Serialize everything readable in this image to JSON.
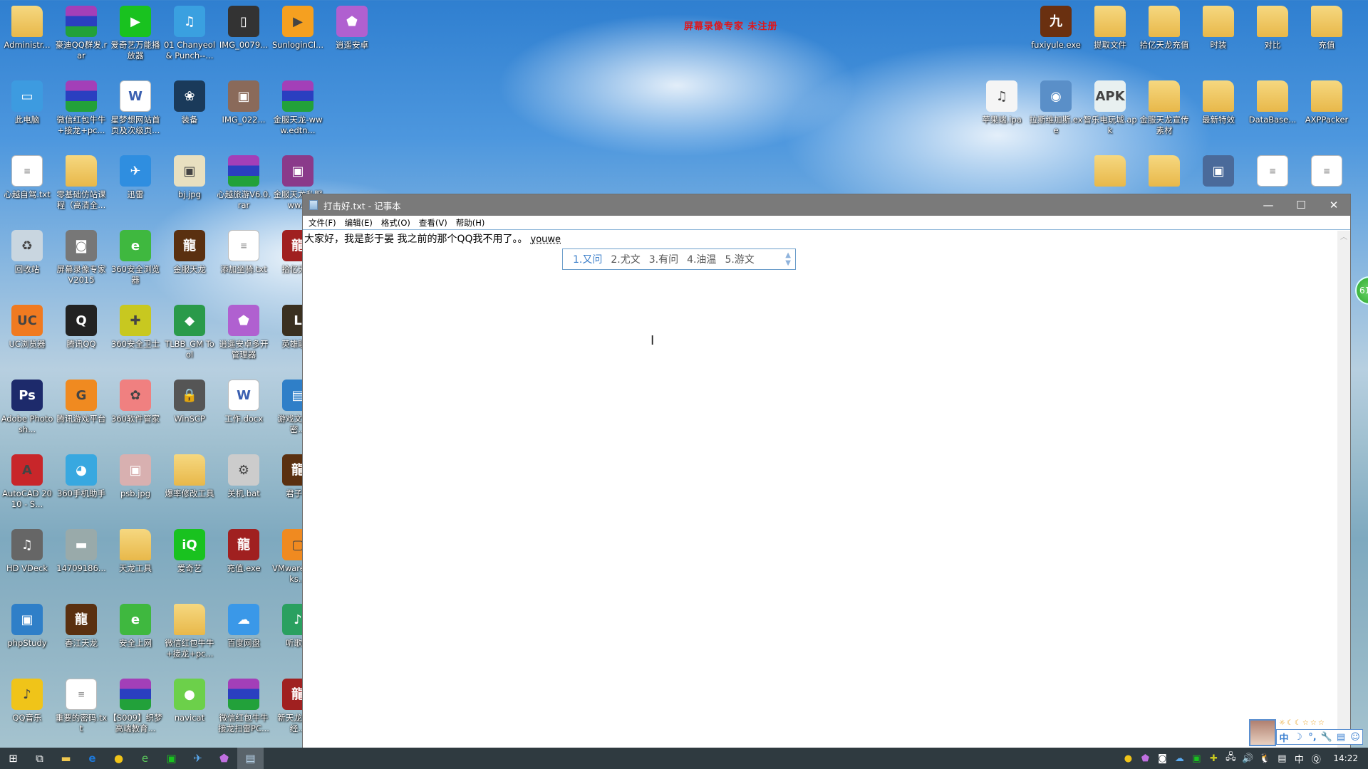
{
  "watermark": "屏幕录像专家  未注册",
  "desktop_left": [
    [
      {
        "label": "Administr...",
        "kind": "folder",
        "color": "#e8b84a"
      },
      {
        "label": "此电脑",
        "kind": "app",
        "color": "#3d9be0",
        "glyph": "▭"
      },
      {
        "label": "心越自驾.txt",
        "kind": "txt"
      },
      {
        "label": "回收站",
        "kind": "app",
        "color": "#c9d6e0",
        "glyph": "♻"
      },
      {
        "label": "UC浏览器",
        "kind": "app",
        "color": "#f07a20",
        "glyph": "UC"
      },
      {
        "label": "Adobe Photosh...",
        "kind": "app",
        "color": "#1d2a6b",
        "glyph": "Ps"
      },
      {
        "label": "AutoCAD 2010 - S...",
        "kind": "app",
        "color": "#c8262a",
        "glyph": "A"
      },
      {
        "label": "HD VDeck",
        "kind": "app",
        "color": "#666",
        "glyph": "♫"
      },
      {
        "label": "phpStudy",
        "kind": "app",
        "color": "#2f7fc8",
        "glyph": "▣"
      },
      {
        "label": "QQ音乐",
        "kind": "app",
        "color": "#f0c419",
        "glyph": "♪"
      }
    ],
    [
      {
        "label": "豪迪QQ群发.rar",
        "kind": "rar"
      },
      {
        "label": "微信红包牛牛+接龙+pc...",
        "kind": "rar"
      },
      {
        "label": "零基础仿站课程（高清全...",
        "kind": "folder"
      },
      {
        "label": "屏幕录像专家V2015",
        "kind": "app",
        "color": "#777",
        "glyph": "◙"
      },
      {
        "label": "腾讯QQ",
        "kind": "app",
        "color": "#222",
        "glyph": "Q"
      },
      {
        "label": "腾讯游戏平台",
        "kind": "app",
        "color": "#f08a20",
        "glyph": "G"
      },
      {
        "label": "360手机助手",
        "kind": "app",
        "color": "#38a8e0",
        "glyph": "◕"
      },
      {
        "label": "14709186...",
        "kind": "app",
        "color": "#9aa",
        "glyph": "▬"
      },
      {
        "label": "香江天龙",
        "kind": "app",
        "color": "#5a3010",
        "glyph": "龍"
      },
      {
        "label": "重要的密码.txt",
        "kind": "txt"
      }
    ],
    [
      {
        "label": "爱奇艺万能播放器",
        "kind": "app",
        "color": "#19c21f",
        "glyph": "▶"
      },
      {
        "label": "星梦想网站首页及次级页...",
        "kind": "doc"
      },
      {
        "label": "迅雷",
        "kind": "app",
        "color": "#2f8ee0",
        "glyph": "✈"
      },
      {
        "label": "360安全浏览器",
        "kind": "app",
        "color": "#3fb83f",
        "glyph": "e"
      },
      {
        "label": "360安全卫士",
        "kind": "app",
        "color": "#c8c820",
        "glyph": "✚"
      },
      {
        "label": "360软件管家",
        "kind": "app",
        "color": "#f08080",
        "glyph": "✿"
      },
      {
        "label": "psb.jpg",
        "kind": "app",
        "color": "#d8b0b0",
        "glyph": "▣"
      },
      {
        "label": "天龙工具",
        "kind": "folder"
      },
      {
        "label": "安全上网",
        "kind": "app",
        "color": "#3fb83f",
        "glyph": "e"
      },
      {
        "label": "【S009】织梦高端教育...",
        "kind": "rar"
      }
    ],
    [
      {
        "label": "01 Chanyeol & Punch--...",
        "kind": "app",
        "color": "#3aa0e0",
        "glyph": "♫"
      },
      {
        "label": "装备",
        "kind": "app",
        "color": "#1a3a5a",
        "glyph": "❀"
      },
      {
        "label": "bj.jpg",
        "kind": "app",
        "color": "#e8e0c0",
        "glyph": "▣"
      },
      {
        "label": "金服天龙",
        "kind": "app",
        "color": "#5a3010",
        "glyph": "龍"
      },
      {
        "label": "TLBB_GM Tool",
        "kind": "app",
        "color": "#2a9a4a",
        "glyph": "◆"
      },
      {
        "label": "WinSCP",
        "kind": "app",
        "color": "#555",
        "glyph": "🔒"
      },
      {
        "label": "爆率修改工具",
        "kind": "folder"
      },
      {
        "label": "爱奇艺",
        "kind": "app",
        "color": "#19c21f",
        "glyph": "iQ"
      },
      {
        "label": "微信红包牛牛+接龙+pc...",
        "kind": "folder"
      },
      {
        "label": "navicat",
        "kind": "app",
        "color": "#6cd04a",
        "glyph": "●"
      }
    ],
    [
      {
        "label": "IMG_0079...",
        "kind": "app",
        "color": "#333",
        "glyph": "▯"
      },
      {
        "label": "IMG_022...",
        "kind": "app",
        "color": "#8a6a5a",
        "glyph": "▣"
      },
      {
        "label": "心越旅游V6.0.rar",
        "kind": "rar"
      },
      {
        "label": "添加坐骑.txt",
        "kind": "txt"
      },
      {
        "label": "逍遥安卓多开管理器",
        "kind": "app",
        "color": "#b060d0",
        "glyph": "⬟"
      },
      {
        "label": "工作.docx",
        "kind": "doc"
      },
      {
        "label": "关机.bat",
        "kind": "app",
        "color": "#ccc",
        "glyph": "⚙"
      },
      {
        "label": "充值.exe",
        "kind": "app",
        "color": "#a02020",
        "glyph": "龍"
      },
      {
        "label": "百度网盘",
        "kind": "app",
        "color": "#3a98e8",
        "glyph": "☁"
      },
      {
        "label": "微信红包牛牛接龙扫雷PC...",
        "kind": "rar"
      }
    ],
    [
      {
        "label": "SunloginCl...",
        "kind": "app",
        "color": "#f5a020",
        "glyph": "▶"
      },
      {
        "label": "金服天龙-www.edtn...",
        "kind": "rar"
      },
      {
        "label": "金服天龙私服ww...",
        "kind": "app",
        "color": "#8a3a8a",
        "glyph": "▣"
      },
      {
        "label": "拾亿天...",
        "kind": "app",
        "color": "#a02020",
        "glyph": "龍"
      },
      {
        "label": "英雄联...",
        "kind": "app",
        "color": "#3a3020",
        "glyph": "L"
      },
      {
        "label": "游戏文...解密...",
        "kind": "app",
        "color": "#2f7fc8",
        "glyph": "▤"
      },
      {
        "label": "君子...",
        "kind": "app",
        "color": "#5a3010",
        "glyph": "龍"
      },
      {
        "label": "VMware Works...",
        "kind": "app",
        "color": "#f08a20",
        "glyph": "▢"
      },
      {
        "label": "听歌...",
        "kind": "app",
        "color": "#2aa060",
        "glyph": "♪"
      },
      {
        "label": "新天龙永恒经...",
        "kind": "app",
        "color": "#a02020",
        "glyph": "龍"
      }
    ],
    [
      {
        "label": "逍遥安卓",
        "kind": "app",
        "color": "#b060d0",
        "glyph": "⬟"
      }
    ]
  ],
  "desktop_right": [
    [
      null,
      {
        "label": "fuxiyule.exe",
        "kind": "app",
        "color": "#6a3010",
        "glyph": "九"
      },
      {
        "label": "提取文件",
        "kind": "folder"
      },
      {
        "label": "拾亿天龙充值",
        "kind": "folder"
      },
      {
        "label": "时装",
        "kind": "folder"
      },
      {
        "label": "对比",
        "kind": "folder"
      },
      {
        "label": "充值",
        "kind": "folder"
      }
    ],
    [
      {
        "label": "苹果端.ipa",
        "kind": "app",
        "color": "#f5f5f5",
        "glyph": "♫"
      },
      {
        "label": "拉斯维加斯.exe",
        "kind": "app",
        "color": "#5a8fc8",
        "glyph": "◉"
      },
      {
        "label": "智乐电玩城.apk",
        "kind": "app",
        "color": "#e8f0f0",
        "glyph": "APK"
      },
      {
        "label": "金服天龙宣传素材",
        "kind": "folder"
      },
      {
        "label": "最新特效",
        "kind": "folder"
      },
      {
        "label": "DataBase...",
        "kind": "folder"
      },
      {
        "label": "AXPPacker",
        "kind": "folder"
      }
    ],
    [
      null,
      null,
      {
        "label": "",
        "kind": "folder"
      },
      {
        "label": "",
        "kind": "folder"
      },
      {
        "label": "",
        "kind": "app",
        "color": "#4a6a9a",
        "glyph": "▣"
      },
      {
        "label": "",
        "kind": "txt"
      },
      {
        "label": "",
        "kind": "txt"
      }
    ]
  ],
  "notepad": {
    "title": "打击好.txt - 记事本",
    "menu": [
      "文件(F)",
      "编辑(E)",
      "格式(O)",
      "查看(V)",
      "帮助(H)"
    ],
    "text": "大家好，我是彭于晏 我之前的那个QQ我不用了。。",
    "composition": "youwe",
    "candidates": [
      "1.又问",
      "2.尤文",
      "3.有问",
      "4.油温",
      "5.游文"
    ]
  },
  "badge": "61",
  "ime": {
    "mode": "中",
    "moon": "☽",
    "punct": "°,",
    "tools": "🔧",
    "skin": "▤",
    "smile": "☺",
    "stars": "☼☾☾☆☆☆"
  },
  "tray": {
    "lang": "中",
    "clock": "14:22"
  }
}
